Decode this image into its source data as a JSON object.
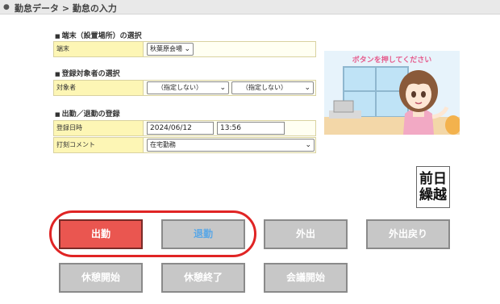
{
  "breadcrumb": {
    "text": "勤怠データ > 勤怠の入力"
  },
  "sections": {
    "terminal": {
      "title": "端末（設置場所）の選択",
      "label": "端末",
      "selected": "秋葉原会場"
    },
    "target": {
      "title": "登録対象者の選択",
      "label": "対象者",
      "select1": "（指定しない）",
      "select2": "（指定しない）"
    },
    "attendance": {
      "title": "出勤／退勤の登録",
      "date_label": "登録日時",
      "date_value": "2024/06/12",
      "time_value": "13:56",
      "comment_label": "打刻コメント",
      "comment_value": "在宅勤務"
    }
  },
  "illustration": {
    "caption": "ボタンを押してください"
  },
  "carry_button": {
    "line1": "前日",
    "line2": "繰越"
  },
  "buttons": {
    "clock_in": "出勤",
    "clock_out": "退勤",
    "go_out": "外出",
    "return": "外出戻り",
    "break_start": "休憩開始",
    "break_end": "休憩終了",
    "meeting_start": "会議開始"
  },
  "colors": {
    "clock_in_bg": "#ea5650",
    "clock_out_text": "#5aa7e6",
    "button_gray": "#c7c7c7",
    "label_bg": "#fdf6b5",
    "highlight_ring": "#e02424"
  },
  "icons": {
    "bullet": "circle-bullet-icon",
    "dropdown": "chevron-down-icon",
    "section": "square-bullet-icon"
  }
}
